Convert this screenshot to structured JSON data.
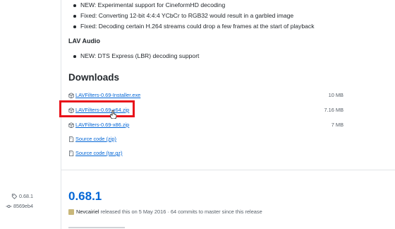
{
  "lav_video": {
    "items": [
      "NEW: Experimental support for CineformHD decoding",
      "Fixed: Converting 12-bit 4:4:4 YCbCr to RGB32 would result in a garbled image",
      "Fixed: Decoding certain H.264 streams could drop a few frames at the start of playback"
    ]
  },
  "lav_audio": {
    "title": "LAV Audio",
    "items": [
      "NEW: DTS Express (LBR) decoding support"
    ]
  },
  "downloads": {
    "heading": "Downloads",
    "assets": [
      {
        "name": "LAVFilters-0.69-Installer.exe",
        "size": "10 MB",
        "icon": "package-icon"
      },
      {
        "name": "LAVFilters-0.69-x64.zip",
        "size": "7.16 MB",
        "icon": "package-icon"
      },
      {
        "name": "LAVFilters-0.69-x86.zip",
        "size": "7 MB",
        "icon": "package-icon"
      },
      {
        "name": "Source code (zip)",
        "size": "",
        "icon": "file-zip-icon"
      },
      {
        "name": "Source code (tar.gz)",
        "size": "",
        "icon": "file-zip-icon"
      }
    ],
    "highlight_color": "#e8121a"
  },
  "next_release": {
    "tag": "0.68.1",
    "commit": "8569eb4",
    "title": "0.68.1",
    "author": "Nevcairiel",
    "meta_rest": " released this on 5 May 2016 · 64 commits to master since this release"
  },
  "colors": {
    "link": "#0366d6",
    "text": "#24292e",
    "muted": "#586069",
    "border": "#e1e4e8"
  }
}
